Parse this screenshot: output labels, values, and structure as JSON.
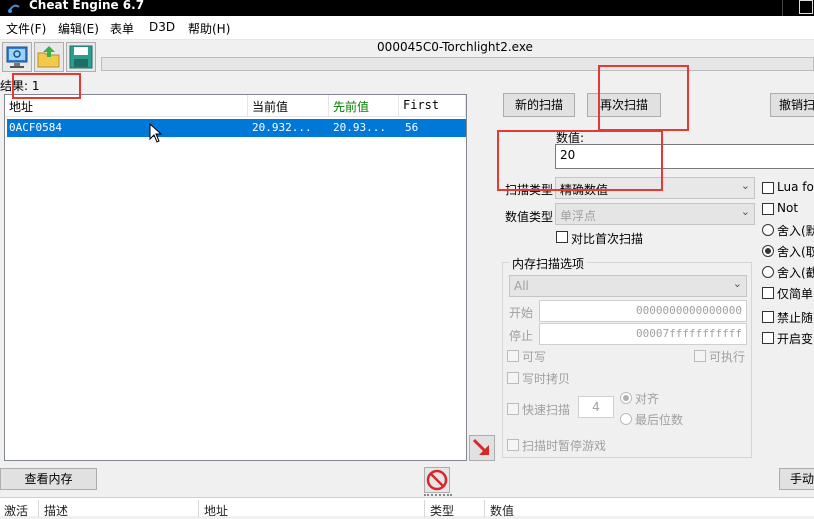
{
  "window": {
    "title": "Cheat Engine 6.7",
    "process": "000045C0-Torchlight2.exe"
  },
  "menu": [
    "文件(F)",
    "编辑(E)",
    "表单",
    "D3D",
    "帮助(H)"
  ],
  "results": {
    "label": "结果: 1",
    "columns": [
      "地址",
      "当前值",
      "先前值",
      "First"
    ],
    "rows": [
      {
        "address": "0ACF0584",
        "current": "20.932...",
        "previous": "20.93...",
        "first": "56"
      }
    ]
  },
  "buttons": {
    "new_scan": "新的扫描",
    "next_scan": "再次扫描",
    "undo_scan": "撤销扫",
    "view_memory": "查看内存",
    "manual": "手动"
  },
  "scan": {
    "value_label": "数值:",
    "value": "20",
    "scan_type_label": "扫描类型",
    "scan_type": "精确数值",
    "value_type_label": "数值类型",
    "value_type": "单浮点",
    "compare_first": "对比首次扫描"
  },
  "right_options": {
    "lua": "Lua fo",
    "not": "Not",
    "round1": "舍入(默",
    "round2": "舍入(取",
    "round3": "舍入(截",
    "simple_only": "仅简单",
    "disable_random": "禁止随",
    "enable_speedhack": "开启变"
  },
  "memory": {
    "group_label": "内存扫描选项",
    "region": "All",
    "start_label": "开始",
    "start": "0000000000000000",
    "stop_label": "停止",
    "stop": "00007fffffffffff",
    "writable": "可写",
    "executable": "可执行",
    "copy_on_write": "写时拷贝",
    "fast_scan": "快速扫描",
    "fast_scan_value": "4",
    "alignment": "对齐",
    "last_digits": "最后位数",
    "pause_game": "扫描时暂停游戏"
  },
  "bottom_columns": [
    "激活",
    "描述",
    "地址",
    "类型",
    "数值"
  ],
  "colors": {
    "selection": "#0078d7",
    "highlight_box": "#e53935",
    "previous_header": "#008000"
  }
}
